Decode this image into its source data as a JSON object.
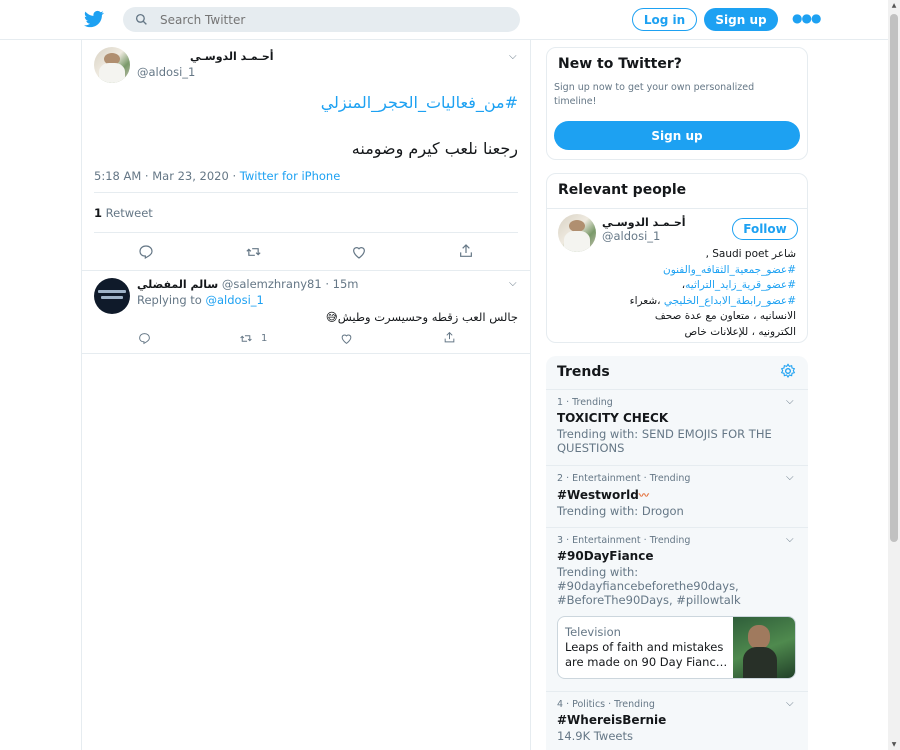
{
  "header": {
    "search_placeholder": "Search Twitter",
    "login_label": "Log in",
    "signup_label": "Sign up",
    "more_icon": "more-icon"
  },
  "tweet": {
    "author_name": "أحـمـد الدوسـي",
    "author_handle": "@aldosi_1",
    "hashtag": "#من_فعاليات_الحجر_المنزلي",
    "text": "رجعنا نلعب كيرم وضومنه",
    "timestamp": "5:18 AM · Mar 23, 2020",
    "source": "Twitter for iPhone",
    "retweet_count": "1",
    "retweet_label": "Retweet"
  },
  "reply": {
    "author_name": "سالم المفضلي",
    "author_handle": "@salemzhrany81",
    "time": "· 15m",
    "replying_to_label": "Replying to",
    "replying_to_handle": "@aldosi_1",
    "text": "جالس العب زقطه وحسيسرت وطيش😅",
    "retweet_count": "1"
  },
  "new_to_twitter": {
    "title": "New to Twitter?",
    "subtitle": "Sign up now to get your own personalized timeline!",
    "button": "Sign up"
  },
  "relevant_people": {
    "title": "Relevant people",
    "name": "أحـمـد الدوسـي",
    "handle": "@aldosi_1",
    "follow_label": "Follow",
    "bio_line1": "شاعر Saudi poet ,",
    "bio_line2": "#عضو_جمعية_الثقافه_والفنون",
    "bio_line3": "#عضو_قرية_زايد_التراثيه",
    "bio_line3_suffix": "،",
    "bio_line4_link": "#عضو_رابطة_الابداع_الخليجي",
    "bio_line4_text": "،شعراء",
    "bio_line5": "الانسانيه ، متعاون مع عدة صحف",
    "bio_line6": "الكترونيه ، للإعلانات خاص"
  },
  "trends": {
    "title": "Trends",
    "items": [
      {
        "meta": "1 · Trending",
        "name": "TOXICITY CHECK",
        "sub": "Trending with: SEND EMOJIS FOR THE QUESTIONS"
      },
      {
        "meta": "2 · Entertainment · Trending",
        "name": "#Westworld",
        "sub": "Trending with: Drogon"
      },
      {
        "meta": "3 · Entertainment · Trending",
        "name": "#90DayFiance",
        "sub": "Trending with: #90dayfiancebeforethe90days, #BeforeThe90Days, #pillowtalk"
      },
      {
        "meta": "4 · Politics · Trending",
        "name": "#WhereisBernie",
        "sub": "14.9K Tweets"
      }
    ],
    "card_category": "Television",
    "card_text": "Leaps of faith and mistakes are made on 90 Day Fianc…"
  },
  "colors": {
    "accent": "#1da1f2",
    "border": "#e6ecf0",
    "muted": "#657786"
  }
}
